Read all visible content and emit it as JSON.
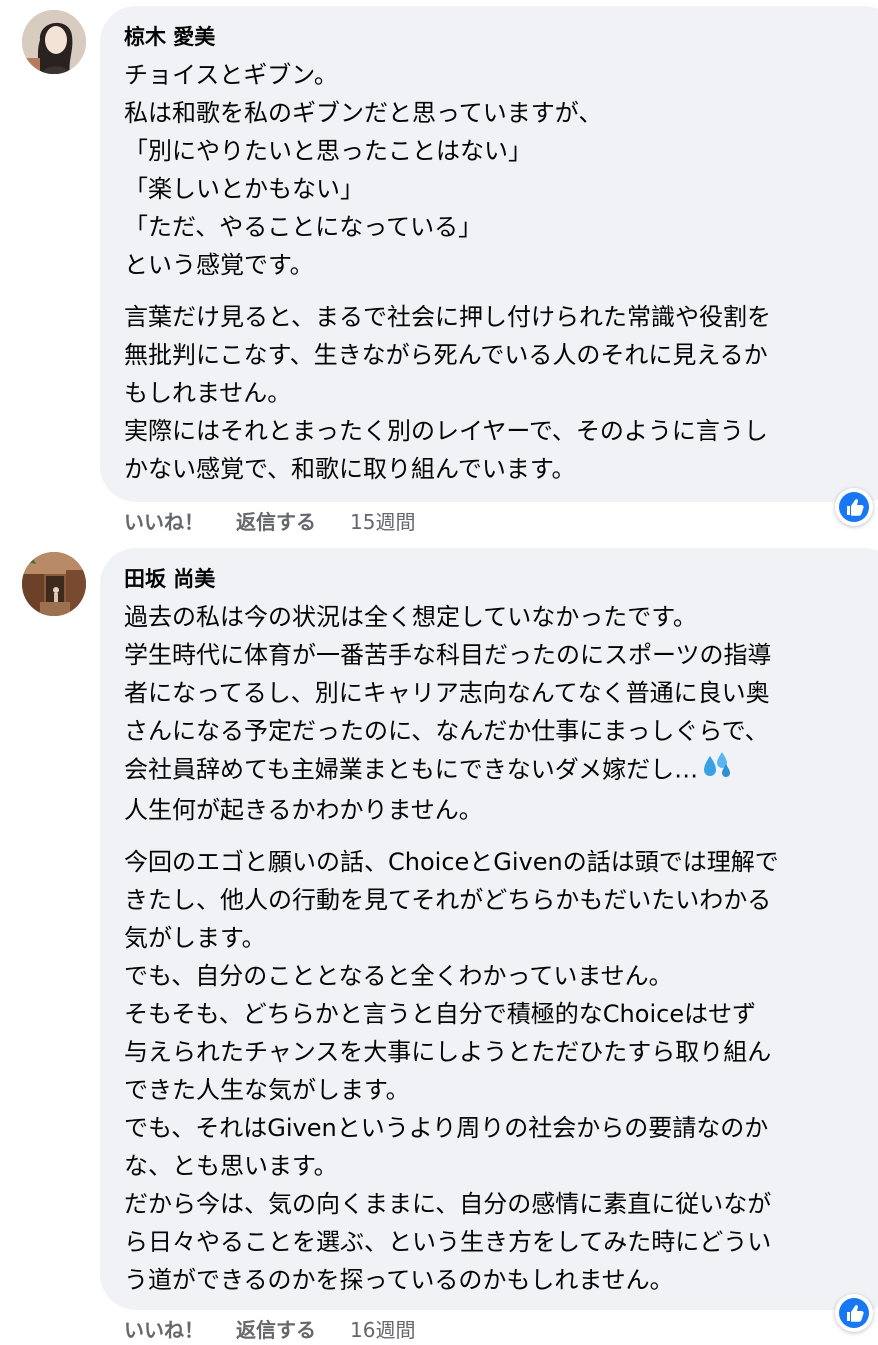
{
  "comments": [
    {
      "author": "椋木 愛美",
      "paragraphs": [
        "チョイスとギブン。\n私は和歌を私のギブンだと思っていますが、\n「別にやりたいと思ったことはない」\n「楽しいとかもない」\n「ただ、やることになっている」\nという感覚です。",
        "言葉だけ見ると、まるで社会に押し付けられた常識や役割を\n無批判にこなす、生きながら死んでいる人のそれに見えるか\nもしれません。\n実際にはそれとまったく別のレイヤーで、そのように言うし\nかない感覚で、和歌に取り組んでいます。"
      ],
      "like_label": "いいね！",
      "reply_label": "返信する",
      "time": "15週間",
      "avatar_icon": "profile-photo",
      "reaction_icon": "thumbs-up-icon"
    },
    {
      "author": "田坂 尚美",
      "paragraphs": [
        "過去の私は今の状況は全く想定していなかったです。\n学生時代に体育が一番苦手な科目だったのにスポーツの指導\n者になってるし、別にキャリア志向なんてなく普通に良い奥\nさんになる予定だったのに、なんだか仕事にまっしぐらで、\n会社員辞めても主婦業まともにできないダメ嫁だし…",
        "人生何が起きるかわかりません。",
        "今回のエゴと願いの話、ChoiceとGivenの話は頭では理解で\nきたし、他人の行動を見てそれがどちらかもだいたいわかる\n気がします。\nでも、自分のこととなると全くわかっていません。\nそもそも、どちらかと言うと自分で積極的なChoiceはせず\n与えられたチャンスを大事にしようとただひたすら取り組ん\nできた人生な気がします。\nでも、それはGivenというより周りの社会からの要請なのか\nな、とも思います。\nだから今は、気の向くままに、自分の感情に素直に従いなが\nら日々やることを選ぶ、という生き方をしてみた時にどうい\nう道ができるのかを探っているのかもしれません。"
      ],
      "like_label": "いいね！",
      "reply_label": "返信する",
      "time": "16週間",
      "avatar_icon": "profile-photo",
      "reaction_icon": "thumbs-up-icon"
    }
  ],
  "colors": {
    "bubble": "#f0f2f5",
    "text": "#050505",
    "secondary": "#65676b",
    "like_blue": "#1877f2"
  }
}
